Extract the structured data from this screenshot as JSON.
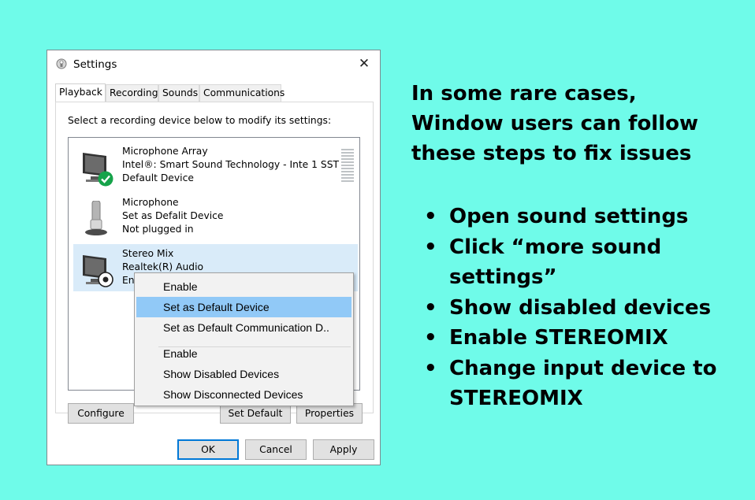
{
  "window": {
    "title": "Settings",
    "close_glyph": "✕",
    "tabs": [
      "Playback",
      "Recording",
      "Sounds",
      "Communications"
    ],
    "active_tab": "Playback",
    "instruction": "Select a recording device below to modify its settings:"
  },
  "devices": [
    {
      "name": "Microphone Array",
      "detail": "Intel®: Smart Sound Technology - Inte 1 SST",
      "status": "Default Device",
      "icon": "monitor-icon",
      "badge": "green-check-badge-icon"
    },
    {
      "name": "Microphone",
      "detail": "Set as Defalit Device",
      "status": "Not plugged in",
      "icon": "microphone-icon"
    },
    {
      "name": "Stereo Mix",
      "detail": "Realtek(R) Audio",
      "status": "En",
      "icon": "monitor-icon",
      "badge": "disabled-badge-icon",
      "selected": true
    }
  ],
  "buttons": {
    "configure": "Configure",
    "set_default": "Set Default",
    "properties": "Properties",
    "ok": "OK",
    "cancel": "Cancel",
    "apply": "Apply"
  },
  "context_menu": {
    "items": [
      "Enable",
      "Set as Default Device",
      "Set as Default Communication D..",
      "Enable",
      "Show Disabled Devices",
      "Show Disconnected Devices"
    ],
    "highlighted": "Set as Default Device"
  },
  "caption": {
    "lines": [
      "In some rare cases,",
      "Window users can follow",
      "these steps to fix issues"
    ]
  },
  "steps": [
    "Open sound settings",
    "Click “more sound settings”",
    "Show disabled devices",
    "Enable STEREOMIX",
    "Change input device to STEREOMIX"
  ],
  "colors": {
    "background": "#6ffbe9",
    "selection": "#d9ebf9",
    "menu_highlight": "#91c9f7",
    "default_check": "#16a34a"
  }
}
